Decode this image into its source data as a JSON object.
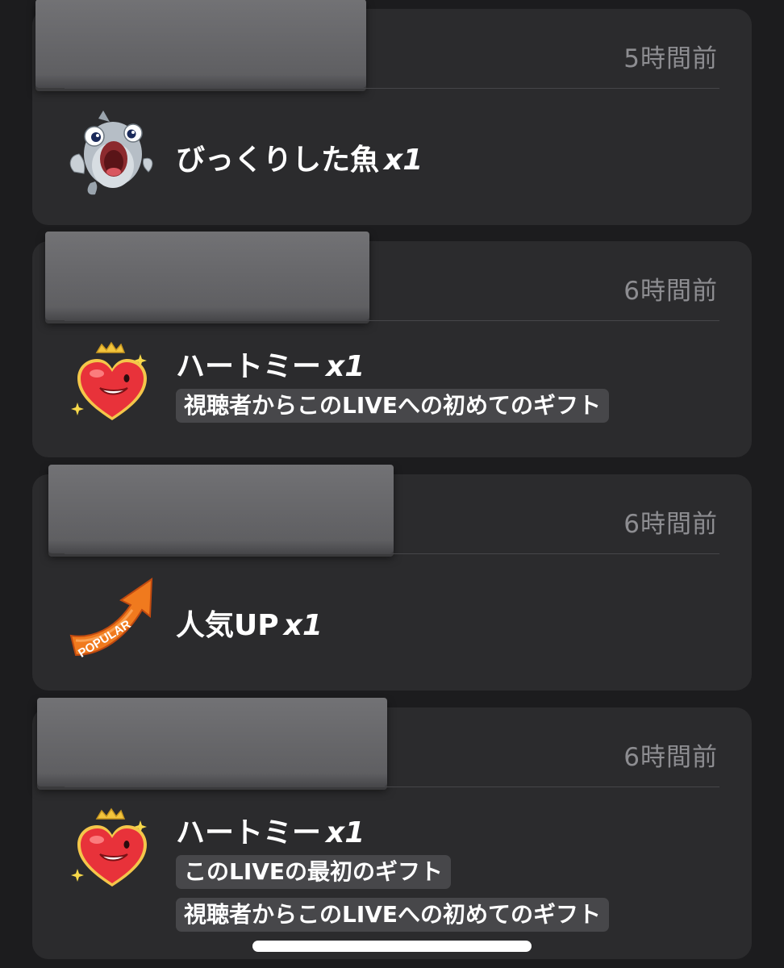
{
  "gifts": [
    {
      "time": "5時間前",
      "name": "びっくりした魚",
      "qty": "x1",
      "icon": "surprised-fish-icon",
      "tags": []
    },
    {
      "time": "6時間前",
      "name": "ハートミー",
      "qty": "x1",
      "icon": "heart-me-icon",
      "tags": [
        "視聴者からこのLIVEへの初めてのギフト"
      ]
    },
    {
      "time": "6時間前",
      "name": "人気UP",
      "qty": "x1",
      "icon": "popular-arrow-icon",
      "icon_text": "POPULAR",
      "tags": []
    },
    {
      "time": "6時間前",
      "name": "ハートミー",
      "qty": "x1",
      "icon": "heart-me-icon",
      "tags": [
        "このLIVEの最初のギフト",
        "視聴者からこのLIVEへの初めてのギフト"
      ]
    }
  ],
  "colors": {
    "background": "#1c1c1e",
    "card": "#2b2b2d",
    "tag": "#47474a",
    "time_text": "#8d8d91",
    "heart": "#e8323a",
    "popular": "#f07a1e"
  }
}
